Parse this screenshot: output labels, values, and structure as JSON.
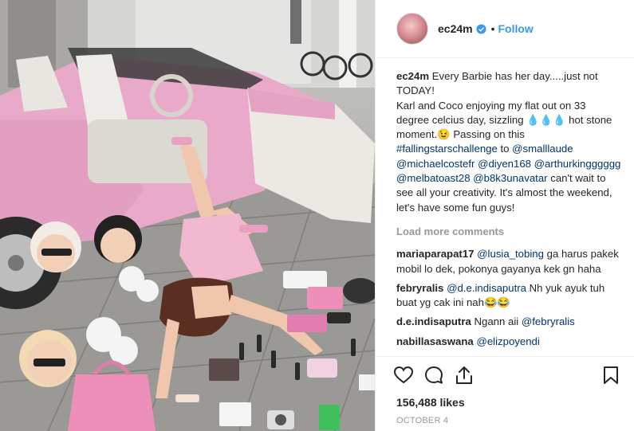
{
  "post": {
    "username": "ec24m",
    "follow_label": "Follow",
    "separator": "•",
    "caption": {
      "user": "ec24m",
      "line1": "Every Barbie has her day.....just not TODAY!",
      "line2": "Karl and Coco enjoying my flat out on 33 degree celcius day, sizzling 💧💧💧 hot stone moment.😉 Passing on this",
      "hashtag": "#fallingstarschallenge",
      "to": "to",
      "m1": "@smalllaude",
      "m2": "@michaelcostefr",
      "m3": "@diyen168",
      "m4": "@arthurkingggggg",
      "m5": "@melbatoast28",
      "m6": "@b8k3unavatar",
      "line3": "can't wait to see all your creativity. It's almost the weekend, let's have some fun guys!"
    },
    "load_more": "Load more comments",
    "comments": [
      {
        "user": "mariaparapat17",
        "mention": "@lusia_tobing",
        "text": "ga harus pakek mobil lo dek, pokonya gayanya kek gn haha"
      },
      {
        "user": "febryralis",
        "mention": "@d.e.indisaputra",
        "text": "Nh yuk ayuk tuh buat yg cak ini nah😂😂"
      },
      {
        "user": "d.e.indisaputra",
        "prefix": "Ngann aii",
        "mention": "@febryralis",
        "text": ""
      },
      {
        "user": "nabillasaswana",
        "mention": "@elizpoyendi",
        "text": ""
      }
    ],
    "likes": "156,488 likes",
    "date": "OCTOBER 4"
  },
  "colors": {
    "accent": "#3897f0",
    "mention": "#003569",
    "car_pink": "#e9a9c8"
  },
  "icons": [
    "heart-icon",
    "comment-icon",
    "share-icon",
    "bookmark-icon",
    "verified-badge-icon"
  ]
}
